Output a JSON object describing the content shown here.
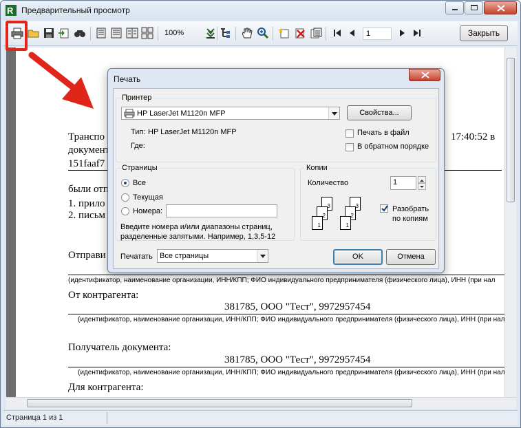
{
  "window": {
    "title": "Предварительный просмотр",
    "close_button": "Закрыть",
    "zoom": "100%",
    "page_number": "1"
  },
  "toolbar": {
    "icons": [
      "print-icon",
      "open-icon",
      "save-icon",
      "export-icon",
      "find-icon",
      "one-page-icon",
      "page-width-icon",
      "two-pages-icon",
      "four-pages-icon",
      "zoom-dropdown",
      "outline-icon",
      "tree-icon",
      "hand-icon",
      "magnify-icon",
      "new-page-icon",
      "delete-page-icon",
      "edit-page-icon",
      "first-page-icon",
      "prev-page-icon",
      "next-page-icon",
      "last-page-icon"
    ]
  },
  "status": {
    "page_text": "Страница 1 из 1"
  },
  "document": {
    "line1_left": "Транспо",
    "line1_right": "17:40:52 в",
    "line2": "документ",
    "line3": "151faaf7",
    "line4": "были отп",
    "line5": "1. прило",
    "line6": "2. письм",
    "sender": "Отправи",
    "caption": "(идентификатор, наименование организации, ИНН/КПП;  ФИО индивидуального предпринимателя (физического лица), ИНН (при нал",
    "from_counterparty": "От контрагента:",
    "counterparty_value": "381785, ООО \"Тест\", 9972957454",
    "recipient": "Получатель документа:",
    "recipient_value": "381785, ООО \"Тест\", 9972957454",
    "for_counterparty": "Для контрагента:"
  },
  "dialog": {
    "title": "Печать",
    "printer_group": "Принтер",
    "printer_name": "HP LaserJet M1120n MFP",
    "properties_button": "Свойства...",
    "type_label": "Тип:",
    "type_value": "HP LaserJet M1120n MFP",
    "where_label": "Где:",
    "print_to_file": "Печать в файл",
    "reverse_order": "В обратном порядке",
    "pages_group": "Страницы",
    "all": "Все",
    "current": "Текущая",
    "numbers": "Номера:",
    "hint": "Введите номера и/или диапазоны страниц,\nразделенные запятыми. Например, 1,3,5-12",
    "copies_group": "Копии",
    "quantity_label": "Количество",
    "quantity_value": "1",
    "collate": "Разобрать\nпо копиям",
    "print_label": "Печатать",
    "print_value": "Все страницы",
    "ok_button": "OK",
    "cancel_button": "Отмена"
  },
  "colors": {
    "highlight": "#e0261b",
    "window_bg": "#dfe8f2"
  }
}
